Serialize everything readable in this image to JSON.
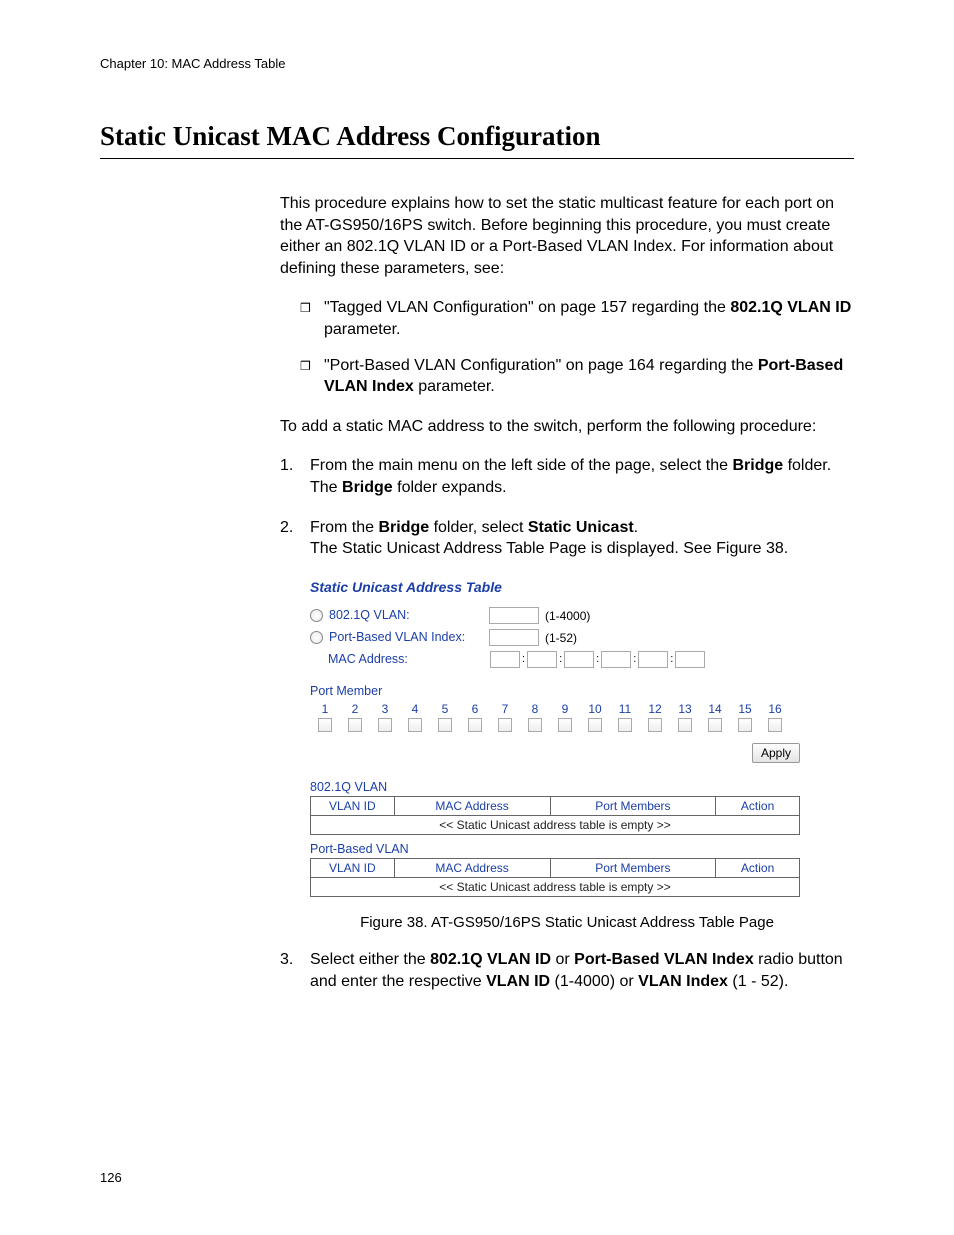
{
  "header": {
    "chapter": "Chapter 10: MAC Address Table"
  },
  "title": "Static Unicast MAC Address Configuration",
  "intro": "This procedure explains how to set the static multicast feature for each port on the AT-GS950/16PS switch. Before beginning this procedure, you must create either an 802.1Q VLAN ID or a Port-Based VLAN Index. For information about defining these parameters, see:",
  "bullets": [
    {
      "pre": "\"Tagged VLAN Configuration\" on page 157 regarding the ",
      "bold": "802.1Q VLAN ID",
      "post": " parameter."
    },
    {
      "pre": "\"Port-Based VLAN Configuration\" on page 164 regarding the ",
      "bold": "Port-Based VLAN Index",
      "post": " parameter."
    }
  ],
  "lead": "To add a static MAC address to the switch, perform the following procedure:",
  "steps": {
    "s1": {
      "num": "1.",
      "t1": "From the main menu on the left side of the page, select the ",
      "b1": "Bridge",
      "t2": " folder.",
      "t3": "The ",
      "b2": "Bridge",
      "t4": " folder expands."
    },
    "s2": {
      "num": "2.",
      "t1": "From the ",
      "b1": "Bridge",
      "t2": " folder, select ",
      "b2": "Static Unicast",
      "t3": ".",
      "t4": "The Static Unicast Address Table Page is displayed. See Figure 38."
    },
    "s3": {
      "num": "3.",
      "t1": "Select either the ",
      "b1": "802.1Q VLAN ID",
      "t2": " or ",
      "b2": "Port-Based VLAN Index",
      "t3": " radio button and enter the respective ",
      "b3": "VLAN ID",
      "t4": " (1-4000) or ",
      "b4": "VLAN Index",
      "t5": " (1 - 52)."
    }
  },
  "panel": {
    "title": "Static Unicast Address Table",
    "vlan1q_label": "802.1Q VLAN:",
    "vlan1q_range": "(1-4000)",
    "pbv_label": "Port-Based VLAN Index:",
    "pbv_range": "(1-52)",
    "mac_label": "MAC Address:",
    "port_member_label": "Port Member",
    "ports": [
      "1",
      "2",
      "3",
      "4",
      "5",
      "6",
      "7",
      "8",
      "9",
      "10",
      "11",
      "12",
      "13",
      "14",
      "15",
      "16"
    ],
    "apply": "Apply",
    "sec1_title": "802.1Q VLAN",
    "sec2_title": "Port-Based VLAN",
    "th_vlanid": "VLAN ID",
    "th_mac": "MAC Address",
    "th_pm": "Port Members",
    "th_action": "Action",
    "empty_msg": "<< Static Unicast address table is empty >>"
  },
  "figure_caption": "Figure 38. AT-GS950/16PS Static Unicast Address Table Page",
  "page_number": "126"
}
